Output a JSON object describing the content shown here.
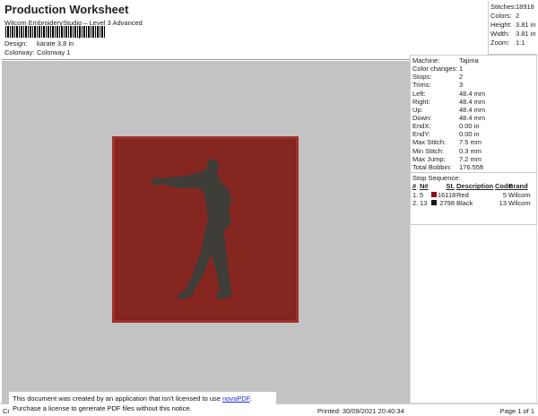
{
  "header": {
    "title": "Production Worksheet",
    "subtitle": "Wilcom EmbroideryStudio – Level 3 Advanced",
    "design_label": "Design:",
    "design_value": "karate 3,8 in",
    "colorway_label": "Colorway:",
    "colorway_value": "Colorway 1"
  },
  "summary": [
    {
      "k": "Stitches:",
      "v": "18918"
    },
    {
      "k": "Colors:",
      "v": "2"
    },
    {
      "k": "Height:",
      "v": "3.81 in"
    },
    {
      "k": "Width:",
      "v": "3.81 in"
    },
    {
      "k": "Zoom:",
      "v": "1:1"
    }
  ],
  "stats": [
    {
      "k": "Machine:",
      "v": "Tajima"
    },
    {
      "k": "Color changes:",
      "v": "1"
    },
    {
      "k": "Stops:",
      "v": "2"
    },
    {
      "k": "Trims:",
      "v": "3"
    },
    {
      "k": "Left:",
      "v": "48.4 mm"
    },
    {
      "k": "Right:",
      "v": "48.4 mm"
    },
    {
      "k": "Up:",
      "v": "48.4 mm"
    },
    {
      "k": "Down:",
      "v": "48.4 mm"
    },
    {
      "k": "EndX:",
      "v": "0.00 in"
    },
    {
      "k": "EndY:",
      "v": "0.00 in"
    },
    {
      "k": "Max Stitch:",
      "v": "7.5 mm"
    },
    {
      "k": "Min Stitch:",
      "v": "0.3 mm"
    },
    {
      "k": "Max Jump:",
      "v": "7.2 mm"
    },
    {
      "k": "Total Bobbin:",
      "v": "176.55ft"
    }
  ],
  "stop_sequence": {
    "label": "Stop Sequence:",
    "headers": [
      "#",
      "N#",
      "St.",
      "Description",
      "Code",
      "Brand"
    ],
    "rows": [
      {
        "idx": "1.",
        "n": "5",
        "color": "#8b0f12",
        "st": "16118",
        "desc": "Red",
        "code": "5",
        "brand": "Wilcom"
      },
      {
        "idx": "2.",
        "n": "13",
        "color": "#1a1a1a",
        "st": "2798",
        "desc": "Black",
        "code": "13",
        "brand": "Wilcom"
      }
    ]
  },
  "design_colors": {
    "patch": "#862621",
    "border": "#9e3229",
    "figure": "#3e3d38"
  },
  "footer": {
    "left": "Cr",
    "printed": "Printed: 30/09/2021 20:40:34",
    "page": "Page 1 of 1"
  },
  "notice": {
    "line1": "This document was created by an application that isn't licensed to use ",
    "link": "novaPDF",
    "line1_end": ".",
    "line2": "Purchase a license to generate PDF files without this notice."
  }
}
